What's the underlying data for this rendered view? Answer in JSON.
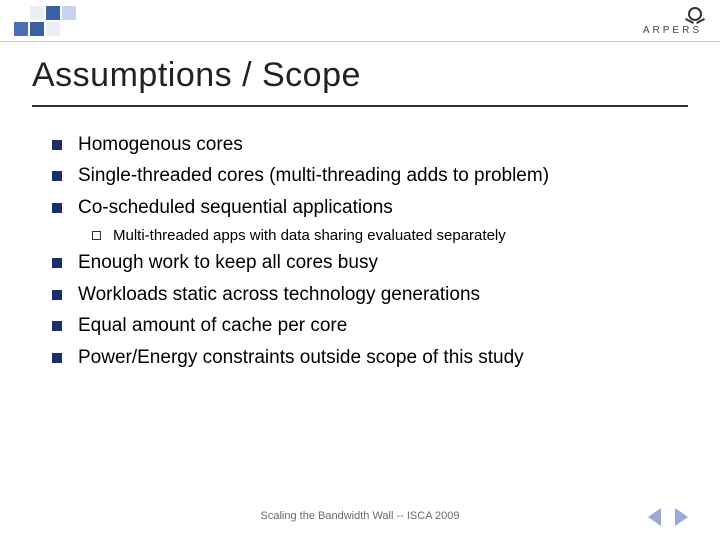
{
  "brand": {
    "name": "ARPERS"
  },
  "title": "Assumptions / Scope",
  "bullets_top": [
    "Homogenous cores",
    "Single-threaded cores (multi-threading adds to problem)",
    "Co-scheduled sequential applications"
  ],
  "sub_bullets": [
    "Multi-threaded apps with data sharing evaluated separately"
  ],
  "bullets_bottom": [
    "Enough work to keep all cores busy",
    "Workloads static across technology generations",
    "Equal amount of cache per core",
    "Power/Energy constraints outside scope of this study"
  ],
  "footer": "Scaling the Bandwidth Wall -- ISCA 2009"
}
